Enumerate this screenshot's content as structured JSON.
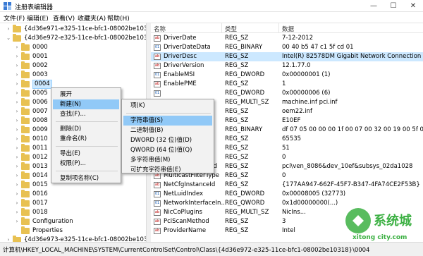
{
  "window": {
    "title": "注册表编辑器",
    "minimize": "—",
    "maximize": "☐",
    "close": "✕"
  },
  "menu": [
    "文件(F)",
    "编辑(E)",
    "查看(V)",
    "收藏夹(A)",
    "帮助(H)"
  ],
  "tree": [
    {
      "label": "{4d36e971-e325-11ce-bfc1-08002be10318}",
      "arrow": "›",
      "level": 1
    },
    {
      "label": "{4d36e972-e325-11ce-bfc1-08002be10318}",
      "arrow": "⌄",
      "level": 1
    },
    {
      "label": "0000",
      "arrow": "›",
      "level": 2
    },
    {
      "label": "0001",
      "arrow": "›",
      "level": 2
    },
    {
      "label": "0002",
      "arrow": "›",
      "level": 2
    },
    {
      "label": "0003",
      "arrow": "›",
      "level": 2
    },
    {
      "label": "0004",
      "arrow": "›",
      "level": 2,
      "selected": true
    },
    {
      "label": "0005",
      "arrow": "›",
      "level": 2
    },
    {
      "label": "0006",
      "arrow": "›",
      "level": 2
    },
    {
      "label": "0007",
      "arrow": "›",
      "level": 2
    },
    {
      "label": "0008",
      "arrow": "›",
      "level": 2
    },
    {
      "label": "0009",
      "arrow": "›",
      "level": 2
    },
    {
      "label": "0010",
      "arrow": "›",
      "level": 2
    },
    {
      "label": "0011",
      "arrow": "›",
      "level": 2
    },
    {
      "label": "0012",
      "arrow": "›",
      "level": 2
    },
    {
      "label": "0013",
      "arrow": "›",
      "level": 2
    },
    {
      "label": "0014",
      "arrow": "›",
      "level": 2
    },
    {
      "label": "0015",
      "arrow": "›",
      "level": 2
    },
    {
      "label": "0016",
      "arrow": "›",
      "level": 2
    },
    {
      "label": "0017",
      "arrow": "›",
      "level": 2
    },
    {
      "label": "0018",
      "arrow": "›",
      "level": 2
    },
    {
      "label": "Configuration",
      "arrow": "›",
      "level": 2
    },
    {
      "label": "Properties",
      "arrow": "",
      "level": 2
    },
    {
      "label": "{4d36e973-e325-11ce-bfc1-08002be10318}",
      "arrow": "›",
      "level": 1
    }
  ],
  "columns": {
    "name": "名称",
    "type": "类型",
    "data": "数据"
  },
  "values": [
    {
      "icon": "ab",
      "name": "DriverDate",
      "type": "REG_SZ",
      "data": "7-12-2012"
    },
    {
      "icon": "bin",
      "name": "DriverDateData",
      "type": "REG_BINARY",
      "data": "00 40 b5 47 c1 5f cd 01"
    },
    {
      "icon": "ab",
      "name": "DriverDesc",
      "type": "REG_SZ",
      "data": "Intel(R) 82578DM Gigabit Network Connection",
      "selected": true
    },
    {
      "icon": "ab",
      "name": "DriverVersion",
      "type": "REG_SZ",
      "data": "12.1.77.0"
    },
    {
      "icon": "bin",
      "name": "EnableMSI",
      "type": "REG_DWORD",
      "data": "0x00000001 (1)"
    },
    {
      "icon": "ab",
      "name": "EnablePME",
      "type": "REG_SZ",
      "data": "1"
    },
    {
      "icon": "bin",
      "name": "",
      "type": "REG_DWORD",
      "data": "0x00000006 (6)"
    },
    {
      "icon": "ab",
      "name": "",
      "type": "REG_MULTI_SZ",
      "data": "machine.inf pci.inf"
    },
    {
      "icon": "ab",
      "name": "",
      "type": "REG_SZ",
      "data": "oem22.inf"
    },
    {
      "icon": "ab",
      "name": "",
      "type": "REG_SZ",
      "data": "E10EF"
    },
    {
      "icon": "bin",
      "name": "",
      "type": "REG_BINARY",
      "data": "df 07 05 00 00 00 1f 00 07 00 32 00 19 00 5f 00"
    },
    {
      "icon": "ab",
      "name": "",
      "type": "REG_SZ",
      "data": "65535"
    },
    {
      "icon": "ab",
      "name": "",
      "type": "REG_SZ",
      "data": "51"
    },
    {
      "icon": "ab",
      "name": "",
      "type": "REG_SZ",
      "data": "0"
    },
    {
      "icon": "ab",
      "name": "MatchingDeviceId",
      "type": "REG_SZ",
      "data": "pci\\ven_8086&dev_10ef&subsys_02da1028"
    },
    {
      "icon": "ab",
      "name": "MulticastFilterType",
      "type": "REG_SZ",
      "data": "0"
    },
    {
      "icon": "ab",
      "name": "NetCfgInstanceId",
      "type": "REG_SZ",
      "data": "{177AA947-662F-45F7-B347-4FA74CE2F53B}"
    },
    {
      "icon": "bin",
      "name": "NetLuidIndex",
      "type": "REG_DWORD",
      "data": "0x00008005 (32773)"
    },
    {
      "icon": "bin",
      "name": "NetworkInterfaceIn...",
      "type": "REG_QWORD",
      "data": "0x1d00000000(...)"
    },
    {
      "icon": "ab",
      "name": "NicCoPlugins",
      "type": "REG_MULTI_SZ",
      "data": "NicIns..."
    },
    {
      "icon": "ab",
      "name": "PciScanMethod",
      "type": "REG_SZ",
      "data": "3"
    },
    {
      "icon": "ab",
      "name": "ProviderName",
      "type": "REG_SZ",
      "data": "Intel"
    }
  ],
  "context_menu": {
    "items": [
      {
        "label": "展开"
      },
      {
        "label": "新建(N)",
        "submenu": true,
        "highlight": true
      },
      {
        "label": "查找(F)..."
      },
      {
        "sep": true
      },
      {
        "label": "删除(D)"
      },
      {
        "label": "重命名(R)"
      },
      {
        "sep": true
      },
      {
        "label": "导出(E)"
      },
      {
        "label": "权限(P)..."
      },
      {
        "sep": true
      },
      {
        "label": "复制项名称(C)"
      }
    ]
  },
  "submenu": {
    "items": [
      {
        "label": "项(K)"
      },
      {
        "sep": true
      },
      {
        "label": "字符串值(S)",
        "highlight": true
      },
      {
        "label": "二进制值(B)"
      },
      {
        "label": "DWORD (32 位)值(D)"
      },
      {
        "label": "QWORD (64 位)值(Q)"
      },
      {
        "label": "多字符串值(M)"
      },
      {
        "label": "可扩充字符串值(E)"
      }
    ]
  },
  "status": "计算机\\HKEY_LOCAL_MACHINE\\SYSTEM\\CurrentControlSet\\Control\\Class\\{4d36e972-e325-11ce-bfc1-08002be10318}\\0004",
  "watermark": {
    "text": "系统城",
    "url": "xitong city.com"
  },
  "colors": {
    "selection": "#cce8ff",
    "menu_highlight": "#91c9f7",
    "folder": "#e8c152",
    "watermark_green": "#3cb043"
  }
}
